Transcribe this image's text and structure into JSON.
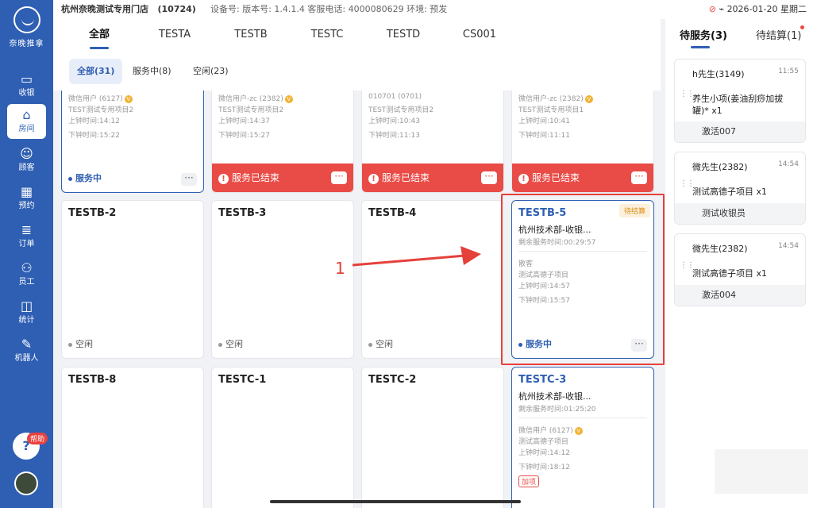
{
  "sidebar": {
    "logo_text": "奈晚推拿",
    "items": [
      {
        "label": "收银",
        "icon": "cashier-icon",
        "glyph": "▭"
      },
      {
        "label": "房间",
        "icon": "home-icon",
        "glyph": "⌂"
      },
      {
        "label": "顾客",
        "icon": "customer-icon",
        "glyph": "☺"
      },
      {
        "label": "预约",
        "icon": "calendar-icon",
        "glyph": "▦"
      },
      {
        "label": "订单",
        "icon": "order-icon",
        "glyph": "≣"
      },
      {
        "label": "员工",
        "icon": "staff-icon",
        "glyph": "⚇"
      },
      {
        "label": "统计",
        "icon": "chart-icon",
        "glyph": "◫"
      },
      {
        "label": "机器人",
        "icon": "robot-icon",
        "glyph": "✎"
      }
    ],
    "help_badge": "帮助"
  },
  "statusbar": {
    "store": "杭州奈晚测试专用门店",
    "store_id": "(10724)",
    "info": "设备号:  版本号: 1.4.1.4  客服电话: 4000080629  环境: 预发",
    "datetime": "2026-01-20 星期二"
  },
  "tabs": [
    "全部",
    "TESTA",
    "TESTB",
    "TESTC",
    "TESTD",
    "CS001"
  ],
  "filters": [
    "全部(31)",
    "服务中(8)",
    "空闲(23)"
  ],
  "top_cards": [
    {
      "user": "微信用户 (6127)",
      "item": "TEST测试专用项目2",
      "on": "上钟时间:14:12",
      "off": "下钟时间:15:22",
      "status": "服务中"
    },
    {
      "user": "微信用户-zc (2382)",
      "item": "TEST测试专用项目2",
      "on": "上钟时间:14:37",
      "off": "下钟时间:15:27",
      "status": "服务已结束"
    },
    {
      "user": "010701 (0701)",
      "item": "TEST测试专用项目2",
      "on": "上钟时间:10:43",
      "off": "下钟时间:11:13",
      "status": "服务已结束"
    },
    {
      "user": "微信用户-zc (2382)",
      "item": "TEST测试专用项目1",
      "on": "上钟时间:10:41",
      "off": "下钟时间:11:11",
      "status": "服务已结束"
    }
  ],
  "idle_label": "空闲",
  "row2": {
    "b2": "TESTB-2",
    "b3": "TESTB-3",
    "b4": "TESTB-4",
    "b5": {
      "title": "TESTB-5",
      "tag": "待结算",
      "tech": "杭州技术部-收银...",
      "remain": "剩余服务时间:00:29:57",
      "user": "散客",
      "item": "测试高德子项目",
      "on": "上钟时间:14:57",
      "off": "下钟时间:15:57",
      "status": "服务中"
    }
  },
  "row3": {
    "b8": "TESTB-8",
    "c1": "TESTC-1",
    "c2": "TESTC-2",
    "c3": {
      "title": "TESTC-3",
      "tech": "杭州技术部-收银...",
      "remain": "剩余服务时间:01:25:20",
      "user": "微信用户 (6127)",
      "item": "测试高德子项目",
      "on": "上钟时间:14:12",
      "off": "下钟时间:18:12",
      "tag": "加项",
      "status": "服务中"
    }
  },
  "annotation": {
    "number": "1"
  },
  "right_panel": {
    "tab_pending": "待服务(3)",
    "tab_settle": "待结算(1)",
    "orders": [
      {
        "name": "h先生(3149)",
        "time": "11:55",
        "item": "养生小项(姜油刮痧加拔罐)* x1",
        "staff": "激活007"
      },
      {
        "name": "微先生(2382)",
        "time": "14:54",
        "item": "测试高德子项目 x1",
        "staff": "测试收银员"
      },
      {
        "name": "微先生(2382)",
        "time": "14:54",
        "item": "测试高德子项目 x1",
        "staff": "激活004"
      }
    ]
  }
}
